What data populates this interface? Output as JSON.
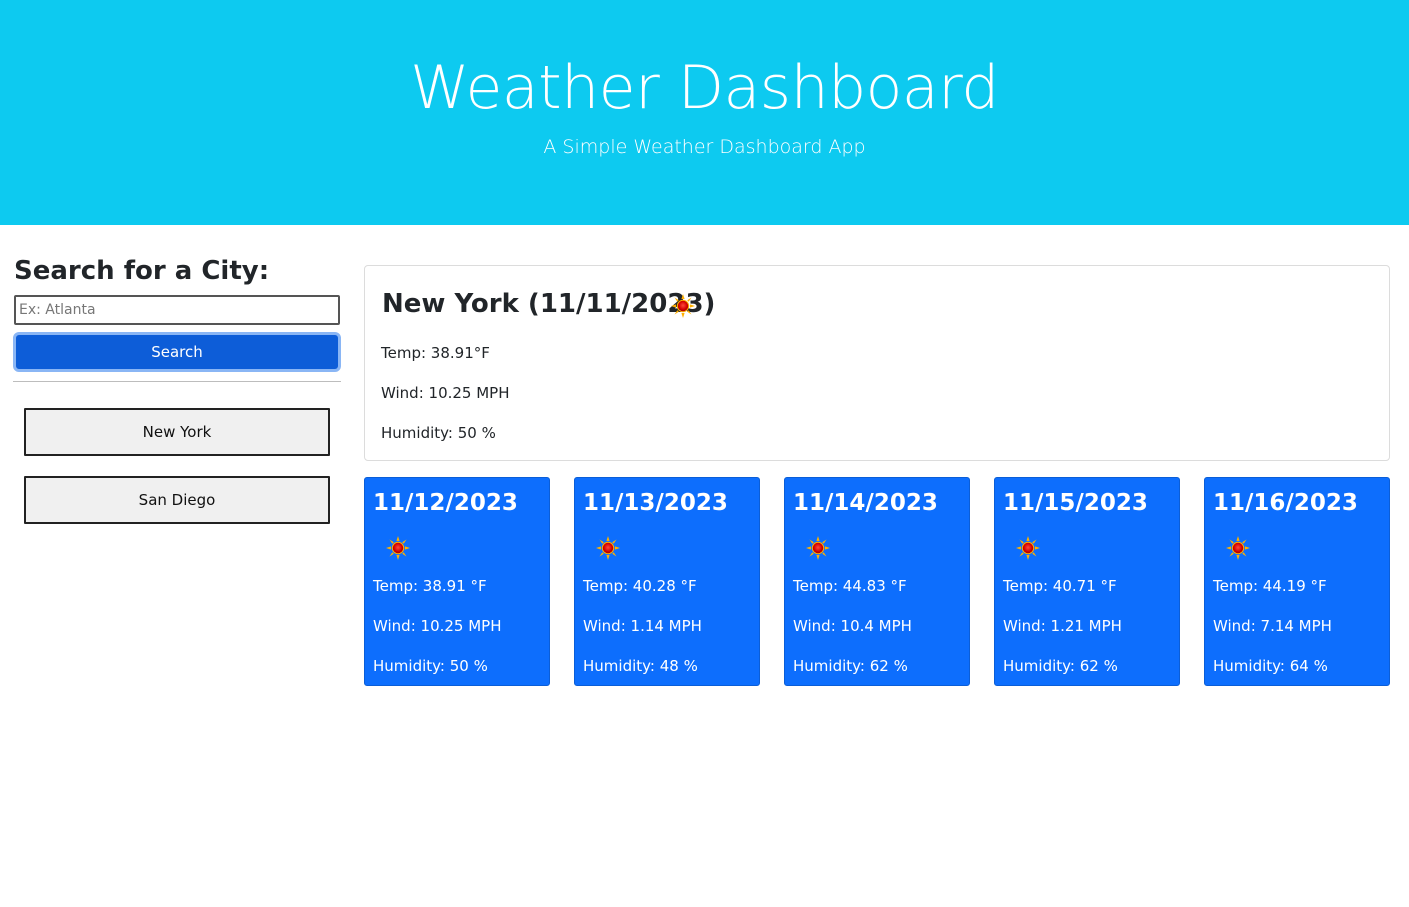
{
  "header": {
    "title": "Weather Dashboard",
    "subtitle": "A Simple Weather Dashboard App",
    "background_color": "#0dcaf0"
  },
  "search": {
    "heading": "Search for a City:",
    "placeholder": "Ex: Atlanta",
    "value": "",
    "button_label": "Search",
    "button_color": "#0d5dd8"
  },
  "history": [
    {
      "label": "New York"
    },
    {
      "label": "San Diego"
    }
  ],
  "current": {
    "title": "New York (11/11/2023)",
    "icon": "sun-icon",
    "temp": "Temp: 38.91°F",
    "wind": "Wind: 10.25 MPH",
    "humidity": "Humidity: 50 %"
  },
  "forecast": [
    {
      "date": "11/12/2023",
      "icon": "sun-icon",
      "temp": "Temp: 38.91 °F",
      "wind": "Wind: 10.25 MPH",
      "humidity": "Humidity: 50 %"
    },
    {
      "date": "11/13/2023",
      "icon": "sun-icon",
      "temp": "Temp: 40.28 °F",
      "wind": "Wind: 1.14 MPH",
      "humidity": "Humidity: 48 %"
    },
    {
      "date": "11/14/2023",
      "icon": "sun-icon",
      "temp": "Temp: 44.83 °F",
      "wind": "Wind: 10.4 MPH",
      "humidity": "Humidity: 62 %"
    },
    {
      "date": "11/15/2023",
      "icon": "sun-icon",
      "temp": "Temp: 40.71 °F",
      "wind": "Wind: 1.21 MPH",
      "humidity": "Humidity: 62 %"
    },
    {
      "date": "11/16/2023",
      "icon": "sun-icon",
      "temp": "Temp: 44.19 °F",
      "wind": "Wind: 7.14 MPH",
      "humidity": "Humidity: 64 %"
    }
  ],
  "colors": {
    "forecast_card": "#0d6efd",
    "text_dark": "#212529"
  }
}
